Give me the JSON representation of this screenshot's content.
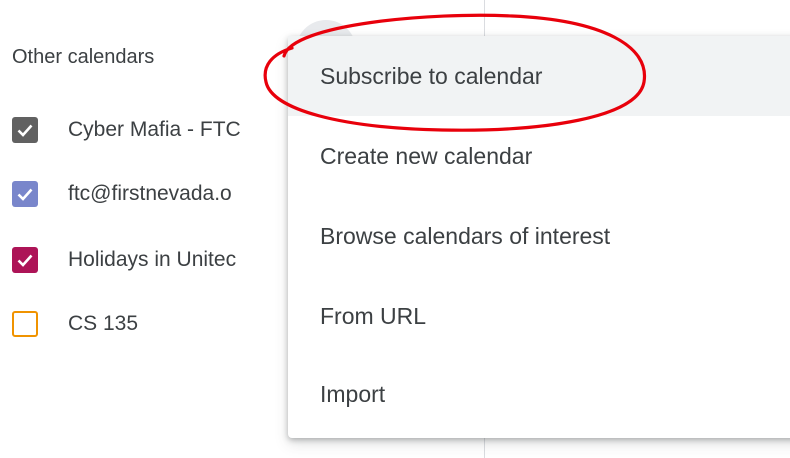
{
  "sidebar": {
    "section_title": "Other calendars",
    "calendars": [
      {
        "label": "Cyber Mafia - FTC",
        "checked": true,
        "color": "#616161"
      },
      {
        "label": "ftc@firstnevada.o",
        "checked": true,
        "color": "#7986cb"
      },
      {
        "label": "Holidays in Unitec",
        "checked": true,
        "color": "#ad1457"
      },
      {
        "label": "CS 135",
        "checked": false,
        "color": "#f09300"
      }
    ]
  },
  "menu": {
    "items": [
      {
        "label": "Subscribe to calendar"
      },
      {
        "label": "Create new calendar"
      },
      {
        "label": "Browse calendars of interest"
      },
      {
        "label": "From URL"
      },
      {
        "label": "Import"
      }
    ]
  },
  "colors": {
    "annotation": "#e8000b",
    "hover": "#f1f3f4"
  }
}
